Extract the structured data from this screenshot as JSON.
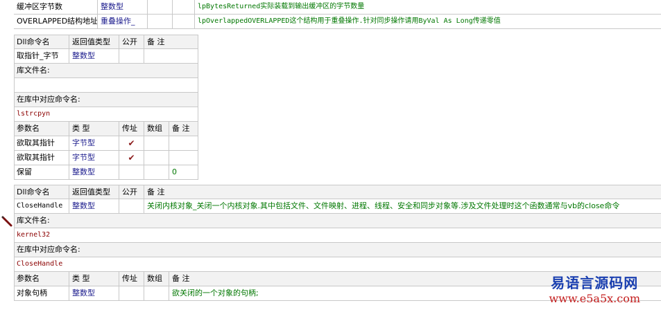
{
  "top_rows": [
    {
      "name": "缓冲区字节数",
      "type": "整数型",
      "note": "lpBytesReturned实际装载到输出缓冲区的字节数量"
    },
    {
      "name": "OVERLAPPED结构地址",
      "type": "重叠操作_",
      "note": "lpOverlappedOVERLAPPED这个结构用于重叠操作.针对同步操作请用ByVal As Long传递零值"
    }
  ],
  "dll_header": {
    "name": "Dll命令名",
    "ret": "返回值类型",
    "public": "公开",
    "note": "备 注"
  },
  "param_header": {
    "name": "参数名",
    "type": "类 型",
    "byref": "传址",
    "array": "数组",
    "note": "备 注"
  },
  "lib_label": "库文件名:",
  "cmd_label": "在库中对应命令名:",
  "block1": {
    "name": "取指针_字节",
    "ret": "整数型",
    "lib": "",
    "cmd": "lstrcpyn",
    "params": [
      {
        "name": "欲取其指针",
        "type": "字节型",
        "byref": "✔",
        "array": "",
        "note": ""
      },
      {
        "name": "欲取其指针",
        "type": "字节型",
        "byref": "✔",
        "array": "",
        "note": ""
      },
      {
        "name": "保留",
        "type": "整数型",
        "byref": "",
        "array": "",
        "note": "0"
      }
    ]
  },
  "block2": {
    "name": "CloseHandle",
    "ret": "整数型",
    "note": "关闭内核对象_关闭一个内核对象.其中包括文件、文件映射、进程、线程、安全和同步对象等.涉及文件处理时这个函数通常与vb的close命令",
    "lib": "kernel32",
    "cmd": "CloseHandle",
    "params": [
      {
        "name": "对象句柄",
        "type": "整数型",
        "byref": "",
        "array": "",
        "note": "欲关闭的一个对象的句柄;"
      }
    ]
  },
  "watermark": {
    "line1": "易语言源码网",
    "line2": "www.e5a5x.com"
  },
  "colors": {
    "grid": "#c8c8c8",
    "type_text": "#1a1a8c",
    "note_text": "#007700",
    "lib_text": "#8b0000",
    "check": "#8b1a1a"
  }
}
